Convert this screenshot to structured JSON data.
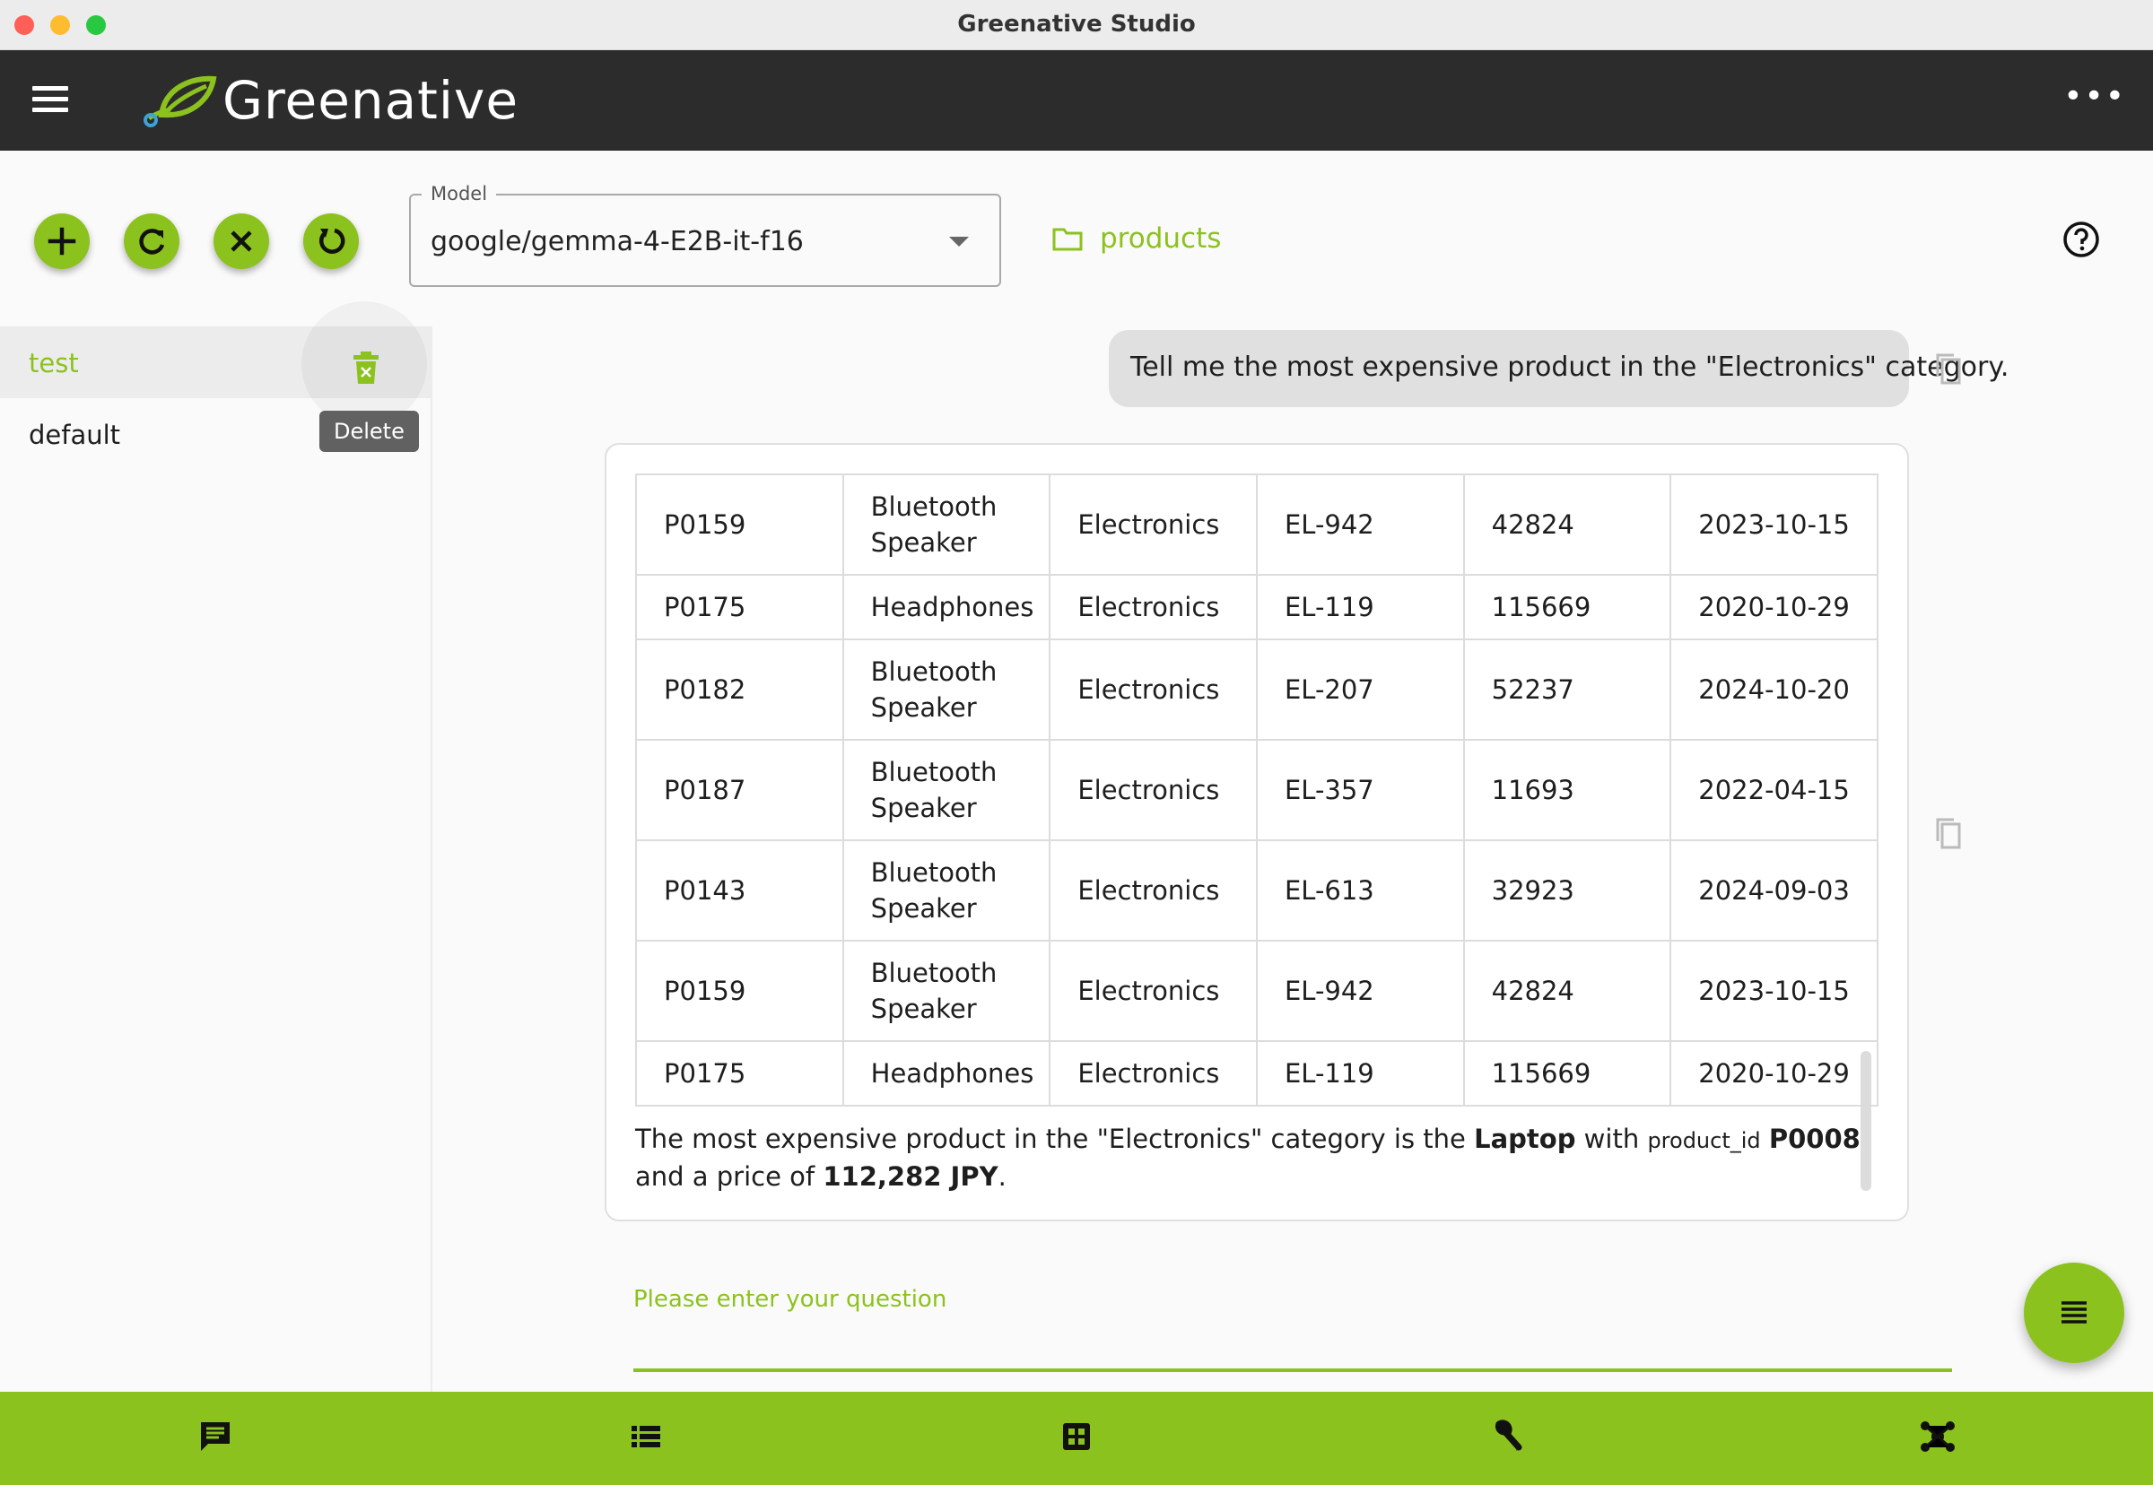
{
  "window": {
    "title": "Greenative Studio"
  },
  "app": {
    "brand": "Greenative",
    "accent": "#8cc21d",
    "header_bg": "#2c2c2c"
  },
  "toolbar": {
    "buttons": [
      {
        "name": "add",
        "icon": "plus-icon"
      },
      {
        "name": "refresh",
        "icon": "refresh-icon"
      },
      {
        "name": "clear",
        "icon": "close-icon"
      },
      {
        "name": "reset",
        "icon": "restore-icon"
      }
    ],
    "model": {
      "label": "Model",
      "value": "google/gemma-4-E2B-it-f16"
    },
    "database": {
      "label": "products",
      "icon": "folder-icon"
    },
    "help_icon": "help-circle-icon"
  },
  "sidebar": {
    "sessions": [
      {
        "label": "test",
        "selected": true
      },
      {
        "label": "default",
        "selected": false
      }
    ],
    "delete_tooltip": "Delete"
  },
  "chat": {
    "user_message": "Tell me the most expensive product in the \"Electronics\" category.",
    "table": {
      "rows": [
        [
          "P0159",
          "Bluetooth Speaker",
          "Electronics",
          "EL-942",
          "42824",
          "2023-10-15"
        ],
        [
          "P0175",
          "Headphones",
          "Electronics",
          "EL-119",
          "115669",
          "2020-10-29"
        ],
        [
          "P0182",
          "Bluetooth Speaker",
          "Electronics",
          "EL-207",
          "52237",
          "2024-10-20"
        ],
        [
          "P0187",
          "Bluetooth Speaker",
          "Electronics",
          "EL-357",
          "11693",
          "2022-04-15"
        ],
        [
          "P0143",
          "Bluetooth Speaker",
          "Electronics",
          "EL-613",
          "32923",
          "2024-09-03"
        ],
        [
          "P0159",
          "Bluetooth Speaker",
          "Electronics",
          "EL-942",
          "42824",
          "2023-10-15"
        ],
        [
          "P0175",
          "Headphones",
          "Electronics",
          "EL-119",
          "115669",
          "2020-10-29"
        ]
      ]
    },
    "answer": {
      "part1": "The most expensive product in the \"Electronics\" category is the ",
      "product": "Laptop",
      "part2": " with ",
      "field": "product_id",
      "part3": " ",
      "id": "P0008",
      "part4": " and a price of ",
      "price": "112,282 JPY",
      "part5": "."
    },
    "input_placeholder": "Please enter your question"
  },
  "bottom_nav": [
    {
      "name": "chat",
      "icon": "chat-icon"
    },
    {
      "name": "list",
      "icon": "list-icon"
    },
    {
      "name": "grid",
      "icon": "grid-icon"
    },
    {
      "name": "tools",
      "icon": "wrench-icon"
    },
    {
      "name": "network",
      "icon": "hub-icon"
    }
  ]
}
